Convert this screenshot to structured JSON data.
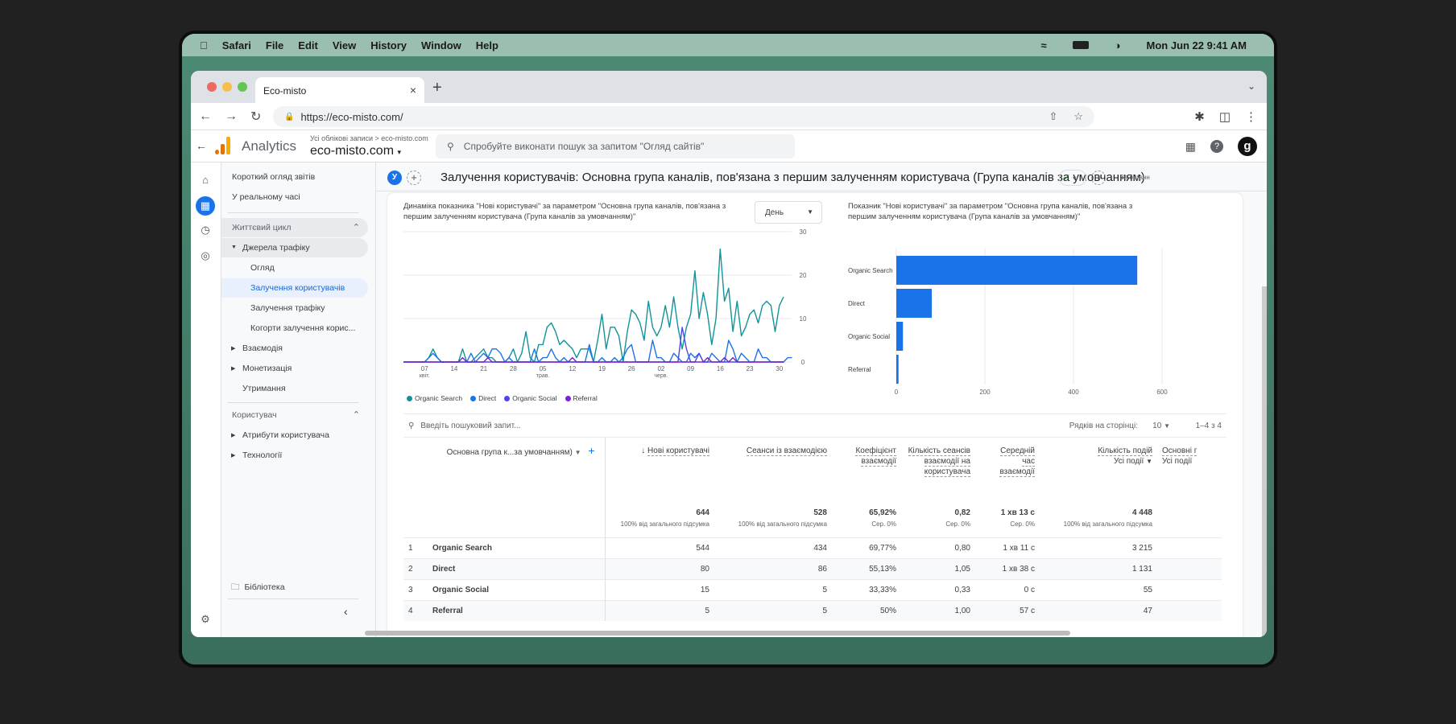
{
  "os_menubar": {
    "apple": "",
    "items": [
      "Safari",
      "File",
      "Edit",
      "View",
      "History",
      "Window",
      "Help"
    ],
    "clock": "Mon Jun 22  9:41 AM"
  },
  "browser": {
    "tab_title": "Eco-misto",
    "new_tab": "+",
    "url": "https://eco-misto.com/"
  },
  "ga_header": {
    "product": "Analytics",
    "breadcrumb": "Усі облікові записи > eco-misto.com",
    "property": "eco-misto.com",
    "search_placeholder": "Спробуйте виконати пошук за запитом \"Огляд сайтів\""
  },
  "sidebar": {
    "items": [
      {
        "label": "Короткий огляд звітів"
      },
      {
        "label": "У реальному часі"
      },
      {
        "label": "Життєвий цикл"
      },
      {
        "label": "Джерела трафіку"
      },
      {
        "label": "Огляд"
      },
      {
        "label": "Залучення користувачів"
      },
      {
        "label": "Залучення трафіку"
      },
      {
        "label": "Когорти залучення корис..."
      },
      {
        "label": "Взаємодія"
      },
      {
        "label": "Монетизація"
      },
      {
        "label": "Утримання"
      },
      {
        "label": "Користувач"
      },
      {
        "label": "Атрибути користувача"
      },
      {
        "label": "Технології"
      },
      {
        "label": "Бібліотека"
      }
    ]
  },
  "page": {
    "segment_badge": "У",
    "title": "Залучення користувачів: Основна група каналів, пов'язана з першим залученням користувача (Група каналів за умовчанням)",
    "date_range": "За останн"
  },
  "line_card": {
    "title": "Динаміка показника \"Нові користувачі\" за параметром \"Основна група каналів, пов'язана з першим залученням користувача (Група каналів за умовчанням)\"",
    "granularity": "День"
  },
  "bar_card": {
    "title": "Показник \"Нові користувачі\" за параметром \"Основна група каналів, пов'язана з першим залученням користувача (Група каналів за умовчанням)\""
  },
  "chart_data": [
    {
      "type": "line",
      "title": "Динаміка показника \"Нові користувачі\"",
      "xlabel": "",
      "ylabel": "",
      "ylim": [
        0,
        30
      ],
      "yticks": [
        0,
        10,
        20,
        30
      ],
      "x_tick_labels": [
        {
          "day": "07",
          "month": "квіт."
        },
        {
          "day": "14",
          "month": ""
        },
        {
          "day": "21",
          "month": ""
        },
        {
          "day": "28",
          "month": ""
        },
        {
          "day": "05",
          "month": "трав."
        },
        {
          "day": "12",
          "month": ""
        },
        {
          "day": "19",
          "month": ""
        },
        {
          "day": "26",
          "month": ""
        },
        {
          "day": "02",
          "month": "черв."
        },
        {
          "day": "09",
          "month": ""
        },
        {
          "day": "16",
          "month": ""
        },
        {
          "day": "23",
          "month": ""
        },
        {
          "day": "30",
          "month": ""
        }
      ],
      "legend_position": "bottom-left",
      "series": [
        {
          "name": "Organic Search",
          "color": "#12939a",
          "values": [
            0,
            0,
            0,
            0,
            0,
            0,
            1,
            3,
            1,
            0,
            0,
            0,
            0,
            0,
            3,
            0,
            0,
            1,
            2,
            3,
            1,
            1,
            0,
            0,
            0,
            1,
            3,
            0,
            2,
            7,
            1,
            0,
            4,
            4,
            8,
            9,
            7,
            4,
            5,
            4,
            3,
            1,
            3,
            3,
            3,
            0,
            5,
            11,
            3,
            8,
            8,
            6,
            0,
            7,
            12,
            11,
            9,
            5,
            14,
            8,
            6,
            8,
            13,
            8,
            15,
            8,
            3,
            8,
            11,
            21,
            10,
            16,
            11,
            4,
            10,
            26,
            14,
            17,
            7,
            14,
            6,
            8,
            11,
            12,
            9,
            13,
            14,
            13,
            7,
            13,
            15
          ]
        },
        {
          "name": "Direct",
          "color": "#1a73e8",
          "values": [
            0,
            0,
            0,
            0,
            0,
            0,
            1,
            2,
            1,
            0,
            0,
            0,
            0,
            0,
            0,
            0,
            2,
            0,
            1,
            2,
            1,
            3,
            3,
            2,
            0,
            1,
            0,
            0,
            0,
            0,
            0,
            3,
            0,
            1,
            1,
            3,
            1,
            0,
            1,
            0,
            0,
            0,
            0,
            0,
            4,
            0,
            0,
            1,
            0,
            0,
            1,
            0,
            1,
            3,
            4,
            0,
            0,
            0,
            0,
            5,
            1,
            1,
            0,
            0,
            2,
            1,
            0,
            0,
            2,
            1,
            2,
            0,
            0,
            2,
            1,
            0,
            0,
            5,
            3,
            0,
            2,
            1,
            0,
            0,
            3,
            1,
            1,
            0,
            0,
            0,
            0,
            1,
            1
          ]
        },
        {
          "name": "Organic Social",
          "color": "#4f46e5",
          "values": [
            0,
            0,
            0,
            0,
            0,
            0,
            0,
            0,
            0,
            0,
            0,
            0,
            0,
            0,
            0,
            0,
            0,
            0,
            0,
            0,
            0,
            0,
            0,
            0,
            0,
            0,
            0,
            0,
            0,
            0,
            0,
            0,
            0,
            0,
            0,
            0,
            0,
            0,
            0,
            0,
            0,
            0,
            0,
            0,
            0,
            0,
            0,
            0,
            0,
            0,
            0,
            0,
            0,
            0,
            0,
            0,
            0,
            0,
            0,
            0,
            0,
            0,
            0,
            0,
            0,
            0,
            8,
            3,
            0,
            0,
            2,
            0,
            0,
            0,
            0,
            0,
            0,
            0,
            0,
            0,
            0,
            0,
            0,
            0,
            0,
            0,
            0,
            0,
            0,
            0,
            0
          ]
        },
        {
          "name": "Referral",
          "color": "#7e22ce",
          "values": [
            0,
            0,
            0,
            0,
            0,
            0,
            0,
            0,
            0,
            0,
            0,
            0,
            0,
            0,
            1,
            0,
            0,
            0,
            0,
            0,
            1,
            0,
            0,
            0,
            0,
            0,
            0,
            0,
            0,
            0,
            0,
            0,
            0,
            0,
            0,
            0,
            0,
            0,
            0,
            0,
            1,
            0,
            0,
            0,
            0,
            0,
            0,
            0,
            0,
            0,
            0,
            0,
            0,
            0,
            0,
            0,
            0,
            0,
            0,
            0,
            0,
            0,
            0,
            0,
            0,
            0,
            0,
            0,
            0,
            0,
            0,
            0,
            1,
            0,
            0,
            0,
            1,
            0,
            1,
            0,
            0,
            0,
            0,
            0,
            0,
            0,
            0,
            0,
            0,
            0,
            0
          ]
        }
      ]
    },
    {
      "type": "bar",
      "orientation": "horizontal",
      "title": "Показник \"Нові користувачі\"",
      "categories": [
        "Organic Search",
        "Direct",
        "Organic Social",
        "Referral"
      ],
      "values": [
        544,
        80,
        15,
        5
      ],
      "xlim": [
        0,
        600
      ],
      "xticks": [
        0,
        200,
        400,
        600
      ],
      "color": "#1a73e8",
      "grid": true
    }
  ],
  "table": {
    "search_placeholder": "Введіть пошуковий запит...",
    "rows_per_page_label": "Рядків на сторінці:",
    "rows_per_page": "10",
    "pagination": "1–4 з 4",
    "dimension_header": "Основна група к...за умовчанням)",
    "columns": [
      {
        "label": "Нові користувачі",
        "sort": "↓"
      },
      {
        "label": "Сеанси із взаємодією"
      },
      {
        "label": "Коефіцієнт взаємодії"
      },
      {
        "label": "Кількість сеансів взаємодії на користувача"
      },
      {
        "label": "Середній час взаємодії"
      },
      {
        "label": "Кількість подій",
        "sub": "Усі події"
      },
      {
        "label": "Основні г",
        "sub": "Усі події"
      }
    ],
    "totals": [
      {
        "value": "644",
        "sub": "100% від загального підсумка"
      },
      {
        "value": "528",
        "sub": "100% від загального підсумка"
      },
      {
        "value": "65,92%",
        "sub": "Сер. 0%"
      },
      {
        "value": "0,82",
        "sub": "Сер. 0%"
      },
      {
        "value": "1 хв 13 с",
        "sub": "Сер. 0%"
      },
      {
        "value": "4 448",
        "sub": "100% від загального підсумка"
      },
      {
        "value": "",
        "sub": ""
      }
    ],
    "rows": [
      {
        "n": "1",
        "dim": "Organic Search",
        "v": [
          "544",
          "434",
          "69,77%",
          "0,80",
          "1 хв 11 с",
          "3 215",
          ""
        ]
      },
      {
        "n": "2",
        "dim": "Direct",
        "v": [
          "80",
          "86",
          "55,13%",
          "1,05",
          "1 хв 38 с",
          "1 131",
          ""
        ]
      },
      {
        "n": "3",
        "dim": "Organic Social",
        "v": [
          "15",
          "5",
          "33,33%",
          "0,33",
          "0 с",
          "55",
          ""
        ]
      },
      {
        "n": "4",
        "dim": "Referral",
        "v": [
          "5",
          "5",
          "50%",
          "1,00",
          "57 с",
          "47",
          ""
        ]
      }
    ]
  }
}
